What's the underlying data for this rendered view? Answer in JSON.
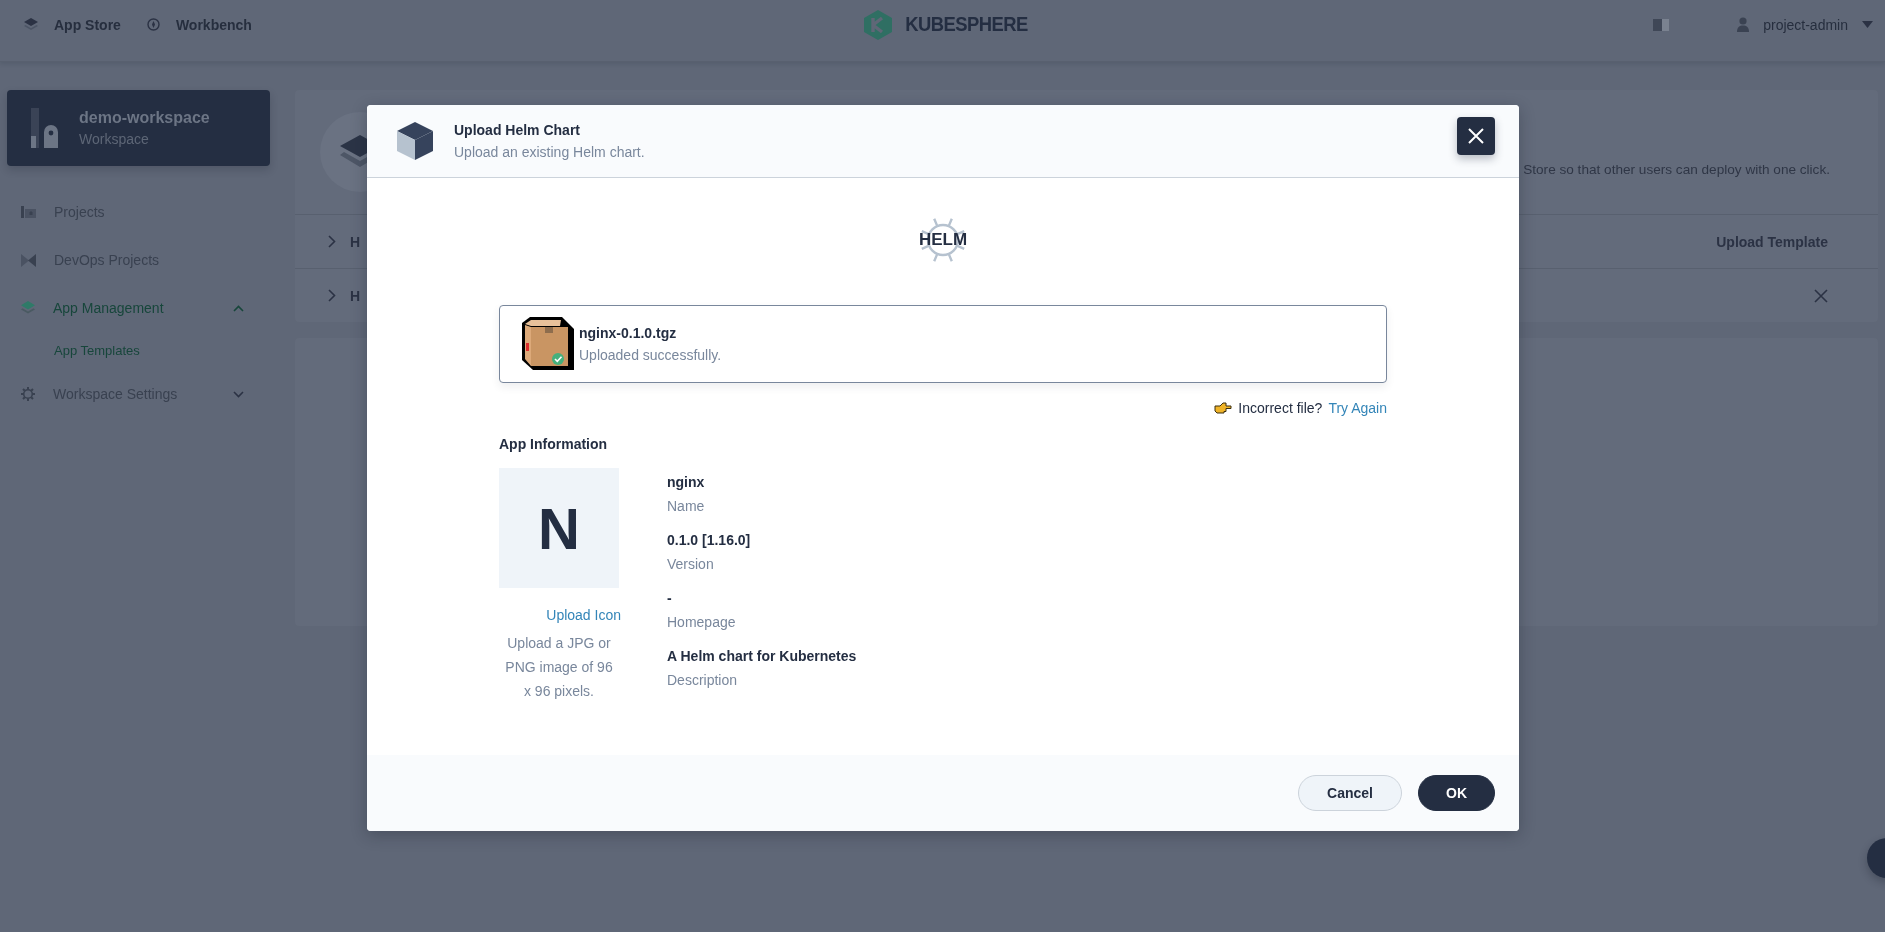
{
  "topbar": {
    "nav": [
      {
        "label": "App Store"
      },
      {
        "label": "Workbench"
      }
    ],
    "logo_text": "KUBESPHERE",
    "user": "project-admin"
  },
  "sidebar": {
    "workspace": {
      "name": "demo-workspace",
      "type": "Workspace"
    },
    "items": [
      {
        "label": "Projects",
        "selected": false
      },
      {
        "label": "DevOps Projects",
        "selected": false
      },
      {
        "label": "App Management",
        "selected": true,
        "expanded": true,
        "children": [
          {
            "label": "App Templates",
            "selected": true
          }
        ]
      },
      {
        "label": "Workspace Settings",
        "selected": false,
        "expanded": false
      }
    ]
  },
  "main": {
    "banner": {
      "description": "Store so that other users can deploy with one click."
    },
    "rows": [
      {
        "label": "H",
        "action": "Upload Template",
        "closable": false
      },
      {
        "label": "H",
        "closable": true
      }
    ]
  },
  "modal": {
    "title": "Upload Helm Chart",
    "subtitle": "Upload an existing Helm chart.",
    "logo_text": "HELM",
    "upload": {
      "filename": "nginx-0.1.0.tgz",
      "status": "Uploaded successfully."
    },
    "retry": {
      "prompt": "Incorrect file?",
      "link": "Try Again"
    },
    "section_title": "App Information",
    "icon_letter": "N",
    "upload_icon": "Upload Icon",
    "icon_hint": "Upload a JPG or PNG image of 96 x 96 pixels.",
    "fields": [
      {
        "value": "nginx",
        "label": "Name"
      },
      {
        "value": "0.1.0 [1.16.0]",
        "label": "Version"
      },
      {
        "value": "-",
        "label": "Homepage"
      },
      {
        "value": "A Helm chart for Kubernetes",
        "label": "Description"
      }
    ],
    "buttons": [
      {
        "label": "Cancel",
        "kind": "secondary"
      },
      {
        "label": "OK",
        "kind": "primary"
      }
    ]
  }
}
